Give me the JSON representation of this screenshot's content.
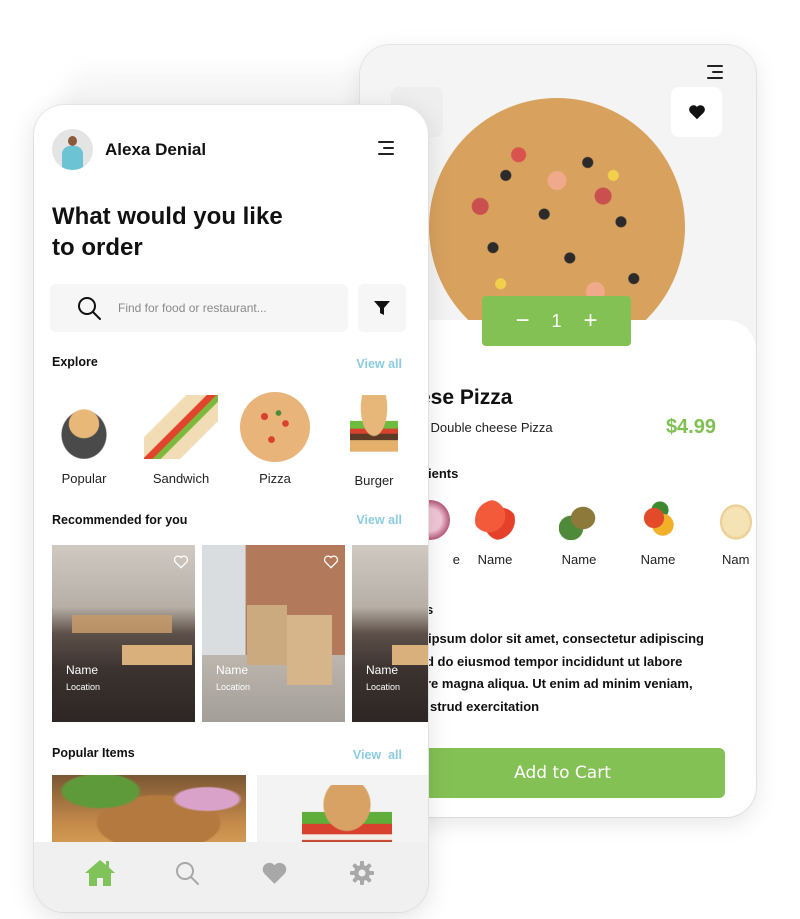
{
  "colors": {
    "accent_green": "#84c155",
    "price_green": "#7ec052",
    "link_blue": "#8ccbe0",
    "nav_inactive": "#a8a8a8"
  },
  "detail_screen": {
    "menu_icon": "menu-icon",
    "back_icon": "back-arrow-icon",
    "favorite_icon": "heart-icon",
    "quantity": {
      "minus": "−",
      "value": "1",
      "plus": "+"
    },
    "title_visible": "ese Pizza",
    "subtitle_visible": "l Double cheese Pizza",
    "price": "$4.99",
    "ingredients_title_visible": "ients",
    "ingredients": [
      {
        "name": "e",
        "icon": "onion-icon"
      },
      {
        "name": "Name",
        "icon": "tomato-icon"
      },
      {
        "name": "Name",
        "icon": "olives-icon"
      },
      {
        "name": "Name",
        "icon": "bell-pepper-icon"
      },
      {
        "name": "Nam",
        "icon": "cheese-icon"
      }
    ],
    "details_title_visible": "s",
    "details_lines_visible": [
      "ipsum dolor sit amet, consectetur adipiscing",
      "d do eiusmod tempor incididunt ut labore",
      "re magna aliqua. Ut enim ad minim veniam,",
      "strud exercitation"
    ],
    "add_to_cart": "Add to Cart"
  },
  "home_screen": {
    "user": {
      "name": "Alexa Denial",
      "avatar": "user-avatar"
    },
    "menu_icon": "menu-icon",
    "headline_line1": "What would you like",
    "headline_line2": "to order",
    "search": {
      "placeholder": "Find for food or restaurant...",
      "value": ""
    },
    "filter_icon": "filter-icon",
    "explore": {
      "title": "Explore",
      "view_all": "View all",
      "categories": [
        {
          "label": "Popular",
          "icon": "noodles-plate-icon"
        },
        {
          "label": "Sandwich",
          "icon": "sandwich-icon"
        },
        {
          "label": "Pizza",
          "icon": "pizza-icon"
        },
        {
          "label": "Burger",
          "icon": "burger-icon"
        }
      ]
    },
    "recommended": {
      "title": "Recommended for you",
      "view_all": "View all",
      "items": [
        {
          "name": "Name",
          "location": "Location"
        },
        {
          "name": "Name",
          "location": "Location"
        },
        {
          "name": "Name",
          "location": "Location"
        }
      ]
    },
    "popular": {
      "title": "Popular Items",
      "view_all": "View  all",
      "items": [
        {
          "icon": "biryani-icon"
        },
        {
          "icon": "burger-icon"
        }
      ]
    },
    "bottom_nav": [
      {
        "id": "home",
        "icon": "home-icon",
        "active": true
      },
      {
        "id": "search",
        "icon": "search-icon",
        "active": false
      },
      {
        "id": "favorites",
        "icon": "heart-icon",
        "active": false
      },
      {
        "id": "settings",
        "icon": "gear-icon",
        "active": false
      }
    ]
  }
}
